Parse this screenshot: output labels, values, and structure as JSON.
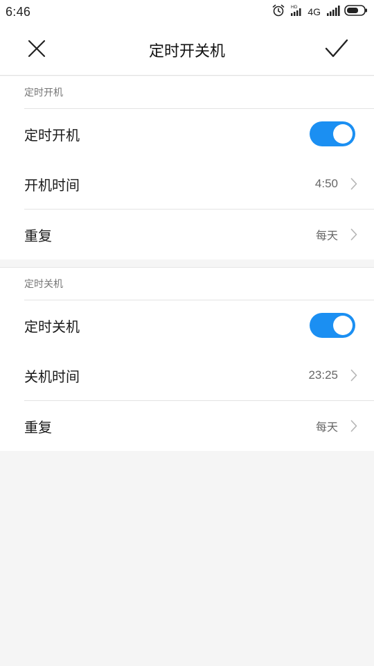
{
  "status_bar": {
    "time": "6:46",
    "network": "4G",
    "icons": [
      "alarm-icon",
      "hd-signal-icon",
      "cellular-signal-icon",
      "battery-icon"
    ]
  },
  "header": {
    "title": "定时开关机",
    "close_icon": "close-icon",
    "confirm_icon": "check-icon"
  },
  "power_on": {
    "section_title": "定时开机",
    "toggle_label": "定时开机",
    "toggle_on": true,
    "time_label": "开机时间",
    "time_value": "4:50",
    "repeat_label": "重复",
    "repeat_value": "每天"
  },
  "power_off": {
    "section_title": "定时关机",
    "toggle_label": "定时关机",
    "toggle_on": true,
    "time_label": "关机时间",
    "time_value": "23:25",
    "repeat_label": "重复",
    "repeat_value": "每天"
  },
  "colors": {
    "accent": "#1b8ff2",
    "background": "#f5f5f5",
    "divider": "#e3e3e3"
  }
}
